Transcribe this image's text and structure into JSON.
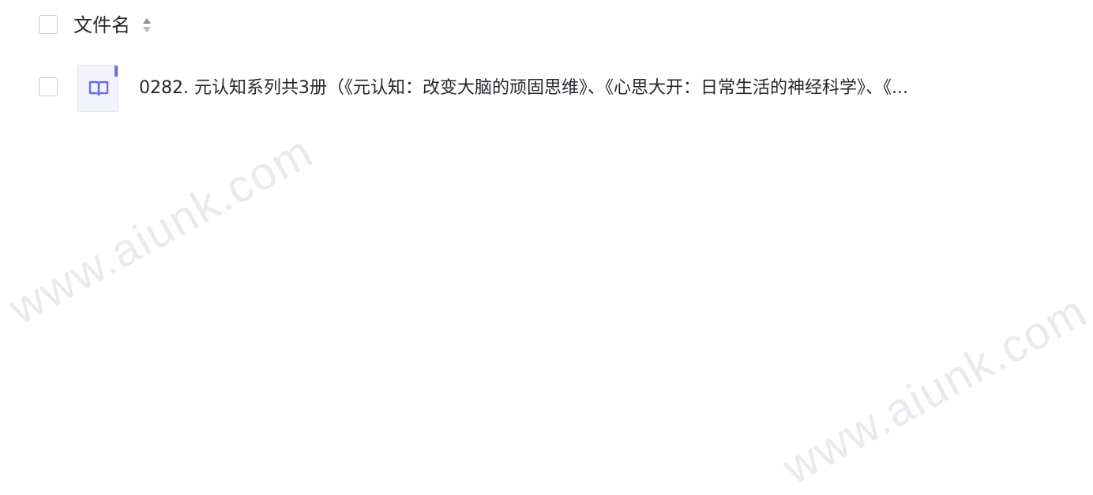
{
  "header": {
    "column_name": "文件名",
    "sort_icon": "sort-updown-icon"
  },
  "files": [
    {
      "name": "0282. 元认知系列共3册（《元认知：改变大脑的顽固思维》、《心思大开：日常生活的神经科学》、《...",
      "icon": "book-icon",
      "accent_color": "#6c6ee0"
    }
  ],
  "watermark": {
    "text": "www.aiunk.com"
  }
}
